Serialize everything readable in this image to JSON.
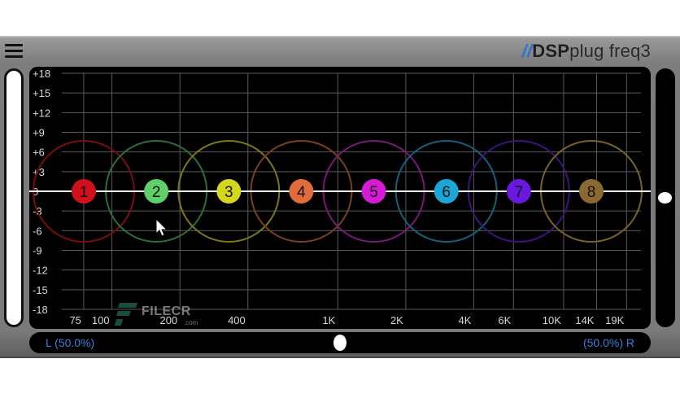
{
  "plugin": {
    "brand": {
      "slashes": "//",
      "dsp": "DSP",
      "plug": "plug freq3"
    },
    "menu_icon": "hamburger-menu-icon"
  },
  "graph": {
    "y_ticks": [
      "+18",
      "+15",
      "+12",
      "+9",
      "+6",
      "+3",
      "0",
      "-3",
      "-6",
      "-9",
      "-12",
      "-15",
      "-18"
    ],
    "x_ticks": [
      "75",
      "100",
      "200",
      "400",
      "1K",
      "2K",
      "4K",
      "6K",
      "10K",
      "14K",
      "19K"
    ],
    "x_ticks_hz": [
      75,
      100,
      200,
      400,
      1000,
      2000,
      4000,
      6000,
      10000,
      14000,
      19000
    ],
    "x_range_hz": [
      60,
      22000
    ],
    "y_range_db": [
      -18,
      18
    ],
    "grid": true,
    "flat_response_db": 0,
    "bands": [
      {
        "label": "1",
        "color": "#d0101a",
        "ring": "#7a0d10",
        "gain_db": 0
      },
      {
        "label": "2",
        "color": "#5fcf6a",
        "ring": "#2f6e36",
        "gain_db": 0
      },
      {
        "label": "3",
        "color": "#d6d61c",
        "ring": "#7c7a18",
        "gain_db": 0
      },
      {
        "label": "4",
        "color": "#e06c3c",
        "ring": "#7d3e22",
        "gain_db": 0
      },
      {
        "label": "5",
        "color": "#d61ad6",
        "ring": "#781a78",
        "gain_db": 0
      },
      {
        "label": "6",
        "color": "#1aa6d6",
        "ring": "#15617a",
        "gain_db": 0
      },
      {
        "label": "7",
        "color": "#6a18e0",
        "ring": "#3a1580",
        "gain_db": 0
      },
      {
        "label": "8",
        "color": "#8a6a32",
        "ring": "#7a6326",
        "gain_db": 0
      }
    ]
  },
  "watermark": {
    "word": "FILECR",
    "domain": ".com"
  },
  "balance": {
    "left_label": "L (50.0%)",
    "right_label": "(50.0%) R",
    "value_percent": 50
  },
  "output_level": {
    "value_db": 0
  }
}
